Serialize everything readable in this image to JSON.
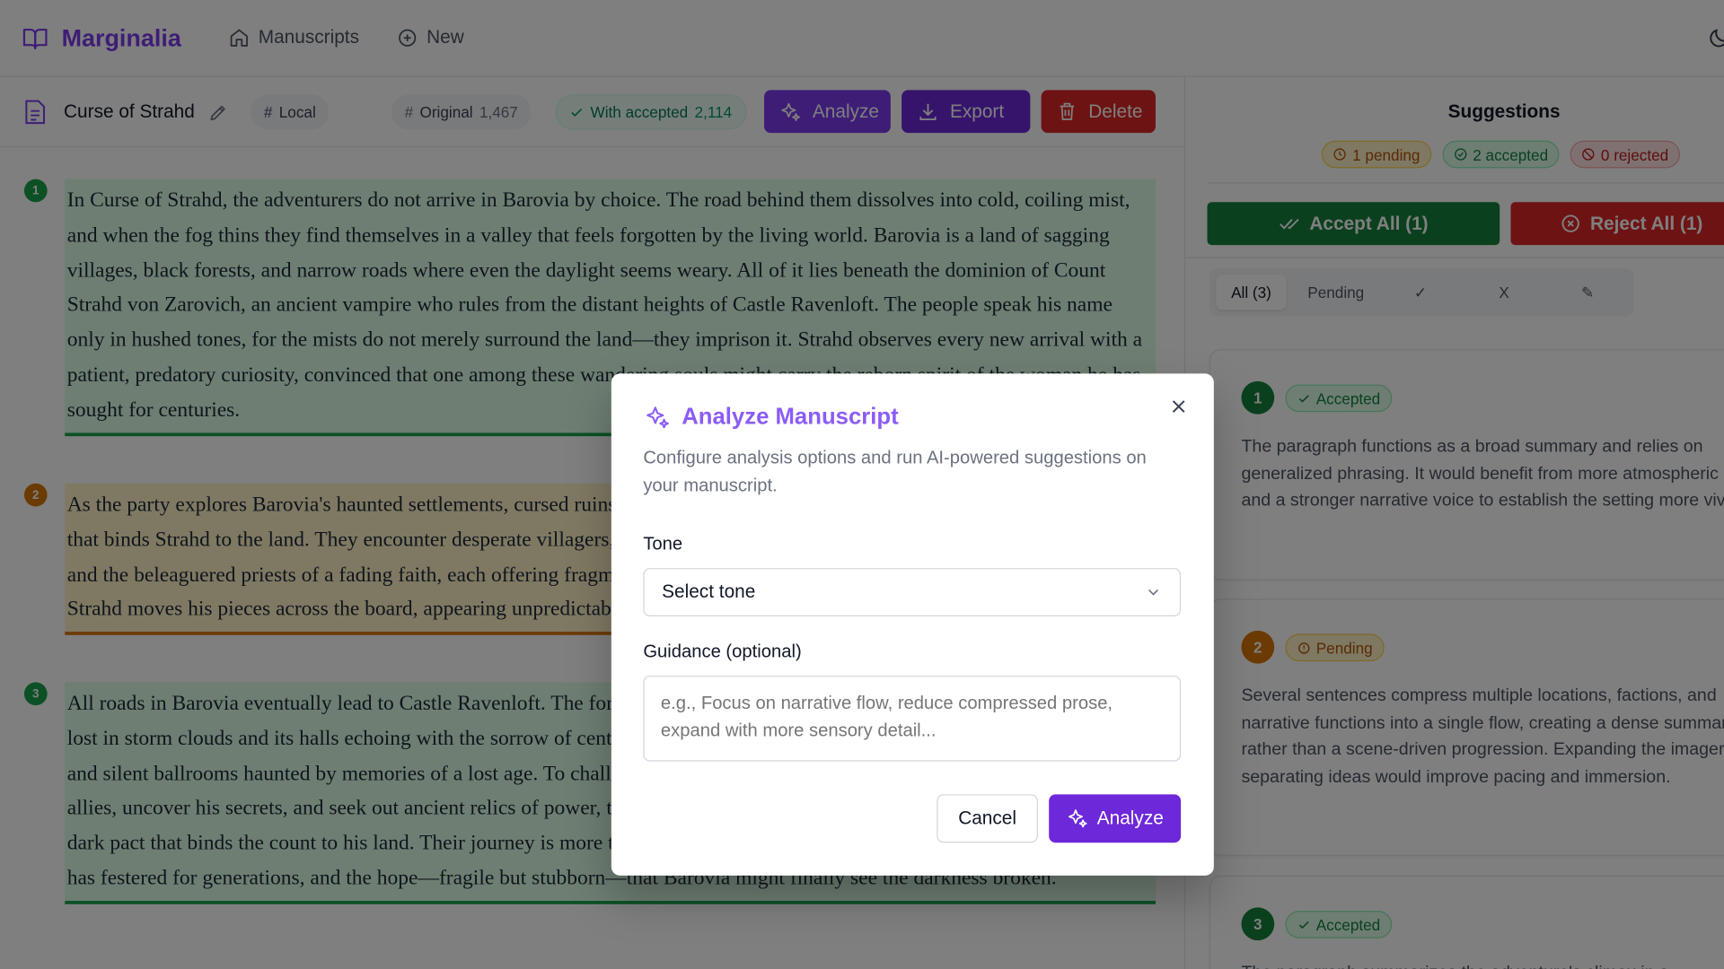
{
  "app": {
    "name": "Marginalia"
  },
  "nav": {
    "manuscripts": "Manuscripts",
    "new": "New"
  },
  "document": {
    "title": "Curse of Strahd",
    "storage": "Local",
    "original_label": "Original",
    "original_count": "1,467",
    "accepted_label": "With accepted",
    "accepted_count": "2,114"
  },
  "toolbar": {
    "analyze": "Analyze",
    "export": "Export",
    "delete": "Delete"
  },
  "paragraphs": [
    {
      "num": "1",
      "status": "accepted",
      "text": "In Curse of Strahd, the adventurers do not arrive in Barovia by choice. The road behind them dissolves into cold, coiling mist, and when the fog thins they find themselves in a valley that feels forgotten by the living world. Barovia is a land of sagging villages, black forests, and narrow roads where even the daylight seems weary. All of it lies beneath the dominion of Count Strahd von Zarovich, an ancient vampire who rules from the distant heights of Castle Ravenloft. The people speak his name only in hushed tones, for the mists do not merely surround the land—they imprison it. Strahd observes every new arrival with a patient, predatory curiosity, convinced that one among these wandering souls might carry the reborn spirit of the woman he has sought for centuries."
    },
    {
      "num": "2",
      "status": "pending",
      "text": "As the party explores Barovia's haunted settlements, cursed ruins, and shadowed wilds, they slowly uncover the tragic history that binds Strahd to the land. They encounter desperate villagers, the wine-making Martikov family, the prophetic Vistani seers, and the beleaguered priests of a fading faith, each offering fragments of guidance, warnings, or cryptic prophecies. Meanwhile Strahd moves his pieces across the board, appearing unpredictably to test, tempt, or torment those who dare defy him."
    },
    {
      "num": "3",
      "status": "accepted",
      "text": "All roads in Barovia eventually lead to Castle Ravenloft. The fortress rises from the cliffs like a crown of dark stone, its towers lost in storm clouds and its halls echoing with the sorrow of centuries. Within lies a maze of candlelit corridors, forgotten crypts, and silent ballrooms haunted by memories of a lost age. To challenge Strahd in his own domain, the heroes must first gather allies, uncover his secrets, and seek out ancient relics of power, the meaning hidden in a Tarokka reading, and the truth of the dark pact that binds the count to his land. Their journey is more than a hunt for a monster. It is a struggle against a sorrow that has festered for generations, and the hope—fragile but stubborn—that Barovia might finally see the darkness broken."
    }
  ],
  "panel": {
    "title": "Suggestions",
    "pending_count": "1 pending",
    "accepted_count": "2 accepted",
    "rejected_count": "0 rejected",
    "accept_all": "Accept All (1)",
    "reject_all": "Reject All (1)",
    "filters": {
      "all": "All (3)",
      "pending": "Pending",
      "accepted": "✓",
      "rejected": "X",
      "edited": "✎"
    }
  },
  "cards": [
    {
      "num": "1",
      "status": "Accepted",
      "text": "The paragraph functions as a broad summary and relies on generalized phrasing. It would benefit from more atmospheric detail and a stronger narrative voice to establish the setting more vividly."
    },
    {
      "num": "2",
      "status": "Pending",
      "text": "Several sentences compress multiple locations, factions, and narrative functions into a single flow, creating a dense summary rather than a scene-driven progression. Expanding the imagery and separating ideas would improve pacing and immersion."
    },
    {
      "num": "3",
      "status": "Accepted",
      "text": "The paragraph summarizes the adventure's climax in a"
    }
  ],
  "modal": {
    "title": "Analyze Manuscript",
    "description": "Configure analysis options and run AI-powered suggestions on your manuscript.",
    "tone_label": "Tone",
    "tone_value": "Select tone",
    "guidance_label": "Guidance (optional)",
    "guidance_placeholder": "e.g., Focus on narrative flow, reduce compressed prose, expand with more sensory detail...",
    "cancel": "Cancel",
    "analyze": "Analyze"
  },
  "colors": {
    "brand": "#7c3aed",
    "accepted": "#16a34a",
    "pending": "#d97706",
    "danger": "#dc2626",
    "primary_button": "#6d28d9"
  }
}
